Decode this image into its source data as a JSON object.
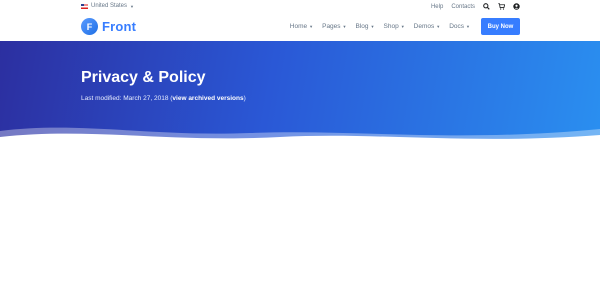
{
  "topbar": {
    "locale": "United States",
    "links": [
      "Help",
      "Contacts"
    ]
  },
  "header": {
    "logo_letter": "F",
    "logo_text": "Front",
    "nav": [
      "Home",
      "Pages",
      "Blog",
      "Shop",
      "Demos",
      "Docs"
    ],
    "buy_label": "Buy Now"
  },
  "hero": {
    "title": "Privacy & Policy",
    "meta_prefix": "Last modified: March 27, 2018 (",
    "meta_link": "view archived versions",
    "meta_suffix": ")"
  },
  "colors": {
    "accent": "#377dff",
    "hero_start": "#2c2fa0",
    "hero_end": "#2a8ff0"
  },
  "icons": [
    "flag-us-icon",
    "search-icon",
    "cart-icon",
    "user-icon",
    "chevron-down-icon"
  ]
}
